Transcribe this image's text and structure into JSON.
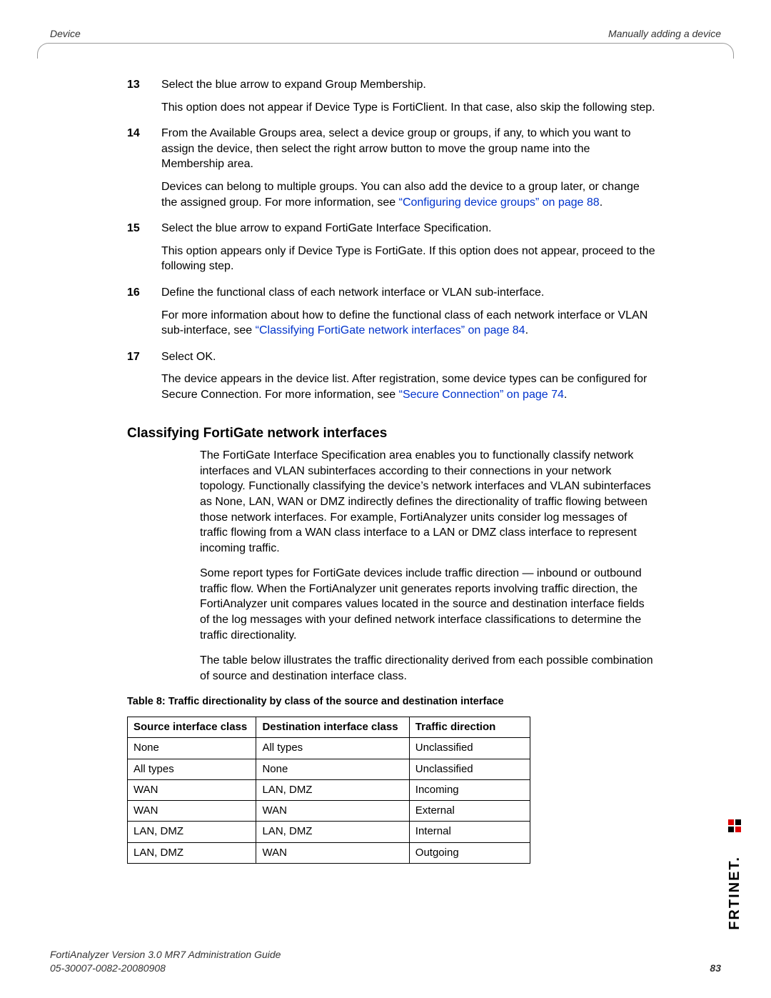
{
  "header": {
    "left": "Device",
    "right": "Manually adding a device"
  },
  "steps": [
    {
      "num": "13",
      "paras": [
        {
          "text": "Select the blue arrow to expand Group Membership."
        },
        {
          "text": "This option does not appear if Device Type is FortiClient. In that case, also skip the following step."
        }
      ]
    },
    {
      "num": "14",
      "paras": [
        {
          "text": "From the Available Groups area, select a device group or groups, if any, to which you want to assign the device, then select the right arrow button to move the group name into the Membership area."
        },
        {
          "text": "Devices can belong to multiple groups. You can also add the device to a group later, or change the assigned group. For more information, see ",
          "link": "“Configuring device groups” on page 88",
          "after": "."
        }
      ]
    },
    {
      "num": "15",
      "paras": [
        {
          "text": "Select the blue arrow to expand FortiGate Interface Specification."
        },
        {
          "text": "This option appears only if Device Type is FortiGate. If this option does not appear, proceed to the following step."
        }
      ]
    },
    {
      "num": "16",
      "paras": [
        {
          "text": "Define the functional class of each network interface or VLAN sub-interface."
        },
        {
          "text": "For more information about how to define the functional class of each network interface or VLAN sub-interface, see ",
          "link": "“Classifying FortiGate network interfaces” on page 84",
          "after": "."
        }
      ]
    },
    {
      "num": "17",
      "paras": [
        {
          "text": "Select OK."
        },
        {
          "text": "The device appears in the device list. After registration, some device types can be configured for Secure Connection. For more information, see ",
          "link": "“Secure Connection” on page 74",
          "after": "."
        }
      ]
    }
  ],
  "section": {
    "heading": "Classifying FortiGate network interfaces",
    "paras": [
      "The FortiGate Interface Specification area enables you to functionally classify network interfaces and VLAN subinterfaces according to their connections in your network topology. Functionally classifying the device’s network interfaces and VLAN subinterfaces as None, LAN, WAN or DMZ indirectly defines the directionality of traffic flowing between those network interfaces. For example, FortiAnalyzer units consider log messages of traffic flowing from a WAN class interface to a LAN or DMZ class interface to represent incoming traffic.",
      "Some report types for FortiGate devices include traffic direction — inbound or outbound traffic flow. When the FortiAnalyzer unit generates reports involving traffic direction, the FortiAnalyzer unit compares values located in the source and destination interface fields of the log messages with your defined network interface classifications to determine the traffic directionality.",
      "The table below illustrates the traffic directionality derived from each possible combination of source and destination interface class."
    ]
  },
  "table": {
    "caption": "Table 8: Traffic directionality by class of the source and destination interface",
    "headers": [
      "Source interface class",
      "Destination interface class",
      "Traffic direction"
    ],
    "rows": [
      [
        "None",
        "All types",
        "Unclassified"
      ],
      [
        "All types",
        "None",
        "Unclassified"
      ],
      [
        "WAN",
        "LAN, DMZ",
        "Incoming"
      ],
      [
        "WAN",
        "WAN",
        "External"
      ],
      [
        "LAN, DMZ",
        "LAN, DMZ",
        "Internal"
      ],
      [
        "LAN, DMZ",
        "WAN",
        "Outgoing"
      ]
    ]
  },
  "footer": {
    "line1": "FortiAnalyzer Version 3.0 MR7 Administration Guide",
    "line2": "05-30007-0082-20080908",
    "page": "83"
  },
  "brand": "F¨RTINET"
}
